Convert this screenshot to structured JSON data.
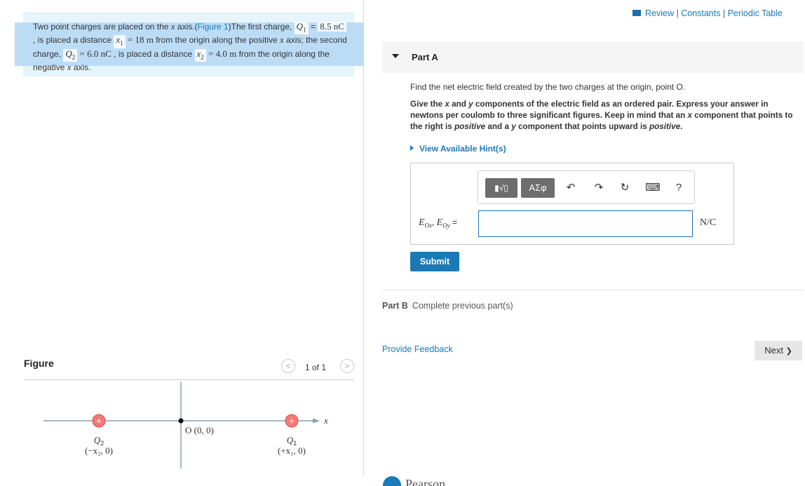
{
  "problem": {
    "t1": "Two point charges are placed on the ",
    "x_italic_1": "x",
    "t2": " axis.(",
    "figure_link": "Figure 1",
    "t3": ")The first charge, ",
    "q1_sym": "Q",
    "q1_sub": "1",
    "eq1": " = ",
    "q1_val": "8.5 nC",
    "t4": " , is placed a distance ",
    "x1_sym": "x",
    "x1_sub": "1",
    "eq2": " = 18 m",
    "t5": " from the origin along the positive ",
    "x_italic_2": "x",
    "t6": " axis; the second charge, ",
    "q2_sym": "Q",
    "q2_sub": "2",
    "eq3": " = 6.0 nC",
    "t7": " , is placed a distance ",
    "x2_sym": "x",
    "x2_sub": "2",
    "eq4": " = 4.0 m",
    "t8": " from the origin along the negative ",
    "x_italic_3": "x",
    "t9": " axis."
  },
  "figure": {
    "title": "Figure",
    "pager": "1 of 1",
    "prev": "<",
    "next": ">",
    "x_axis_label": "x",
    "origin_label": "O (0, 0)",
    "q2_label": "Q",
    "q2_label_sub": "2",
    "q2_coord": "(−x₂, 0)",
    "q1_label": "Q",
    "q1_label_sub": "1",
    "q1_coord": "(+x₁, 0)",
    "plus": "+"
  },
  "header": {
    "review": "Review",
    "sep": " | ",
    "constants": "Constants",
    "periodic_table": "Periodic Table"
  },
  "partA": {
    "title": "Part A",
    "prompt": "Find the net electric field created by the two charges at the origin, point O.",
    "instr_1": "Give the ",
    "instr_x": "x",
    "instr_2": " and ",
    "instr_y": "y",
    "instr_3": " components of the electric field as an ordered pair. Express your answer in newtons per coulomb to three significant figures. Keep in mind that an ",
    "instr_x2": "x",
    "instr_4": " component that points to the right is ",
    "instr_positive1": "positive",
    "instr_5": " and a ",
    "instr_y2": "y",
    "instr_6": " component that points upward is ",
    "instr_positive2": "positive",
    "instr_7": ".",
    "hint": "View Available Hint(s)",
    "toolbar": {
      "templates": "▮√▯",
      "symbols": "ΑΣφ",
      "undo": "↶",
      "redo": "↷",
      "reset": "↻",
      "keyboard": "⌨",
      "help": "?"
    },
    "eq_label_E1": "E",
    "eq_label_sub1": "Ox",
    "eq_label_comma": ", ",
    "eq_label_E2": "E",
    "eq_label_sub2": "Oy",
    "eq_label_eq": " =",
    "answer_value": "",
    "unit": "N/C",
    "submit": "Submit"
  },
  "partB": {
    "label": "Part B",
    "text": "Complete previous part(s)"
  },
  "footer": {
    "feedback": "Provide Feedback",
    "next": "Next",
    "next_arrow": "❯",
    "logo_text": "Pearson"
  }
}
